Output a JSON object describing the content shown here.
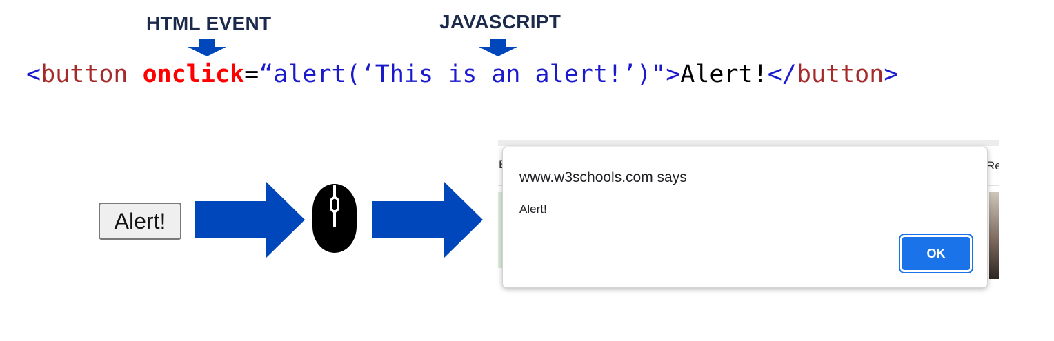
{
  "labels": {
    "html_event": "HTML EVENT",
    "javascript": "JAVASCRIPT"
  },
  "code": {
    "open_bracket": "<",
    "tag_open": "button",
    "space": " ",
    "attribute": "onclick",
    "equals": "=",
    "value": "“alert(‘This is an alert!’)\"",
    "close_bracket": ">",
    "inner_text": "Alert!",
    "end_open_bracket": "</",
    "tag_close": "button",
    "end_close_bracket": ">"
  },
  "demo_button": {
    "label": "Alert!"
  },
  "browser": {
    "left_fragment": "E",
    "right_fragment": "Re"
  },
  "dialog": {
    "title": "www.w3schools.com says",
    "message": "Alert!",
    "ok_label": "OK"
  },
  "colors": {
    "arrow_blue": "#0047bb",
    "label_navy": "#1b2a4a",
    "code_tag": "#a52a2a",
    "code_attr": "#ff0000",
    "code_value": "#1a1acc",
    "ok_blue": "#1a73e8"
  },
  "icons": {
    "event_pointer": "down-arrow-icon",
    "js_pointer": "down-arrow-icon",
    "flow_arrow": "right-arrow-icon",
    "mouse": "mouse-icon"
  }
}
